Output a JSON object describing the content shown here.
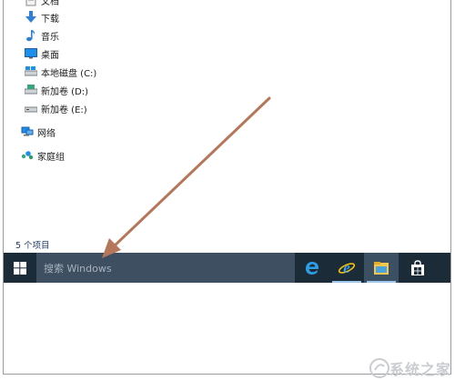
{
  "nav": {
    "items": [
      {
        "label": "文档",
        "icon": "document-icon"
      },
      {
        "label": "下载",
        "icon": "download-icon"
      },
      {
        "label": "音乐",
        "icon": "music-icon"
      },
      {
        "label": "桌面",
        "icon": "desktop-icon"
      },
      {
        "label": "本地磁盘 (C:)",
        "icon": "local-disk-icon"
      },
      {
        "label": "新加卷 (D:)",
        "icon": "drive-icon"
      },
      {
        "label": "新加卷 (E:)",
        "icon": "drive-icon"
      },
      {
        "label": "网络",
        "icon": "network-icon"
      },
      {
        "label": "家庭组",
        "icon": "homegroup-icon"
      }
    ]
  },
  "status_bar": {
    "item_count": "5 个项目"
  },
  "taskbar": {
    "search_placeholder": "搜索 Windows",
    "pinned": [
      {
        "name": "Microsoft Edge",
        "icon": "edge-icon"
      },
      {
        "name": "Internet Explorer",
        "icon": "internet-explorer-icon"
      },
      {
        "name": "File Explorer",
        "icon": "file-explorer-icon",
        "active": true
      },
      {
        "name": "Store",
        "icon": "store-icon"
      }
    ]
  },
  "watermark": {
    "text": "系统之家"
  },
  "colors": {
    "taskbar": "#1c2b38",
    "search": "#3d4f61",
    "arrow": "#b5765a",
    "accent": "#0078d7"
  }
}
